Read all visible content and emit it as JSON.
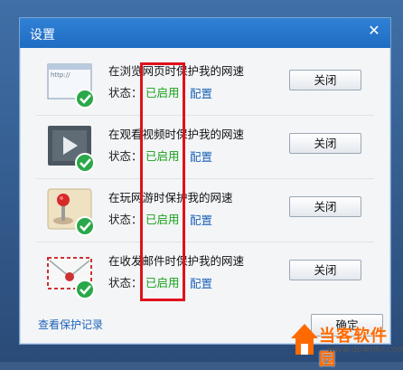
{
  "window": {
    "title": "设置",
    "close_glyph": "✕"
  },
  "rows": [
    {
      "heading": "在浏览网页时保护我的网速",
      "status_label": "状态：",
      "status_value": "已启用",
      "config_label": "配置",
      "button_label": "关闭",
      "icon": "browser-icon"
    },
    {
      "heading": "在观看视频时保护我的网速",
      "status_label": "状态：",
      "status_value": "已启用",
      "config_label": "配置",
      "button_label": "关闭",
      "icon": "video-icon"
    },
    {
      "heading": "在玩网游时保护我的网速",
      "status_label": "状态：",
      "status_value": "已启用",
      "config_label": "配置",
      "button_label": "关闭",
      "icon": "game-icon"
    },
    {
      "heading": "在收发邮件时保护我的网速",
      "status_label": "状态：",
      "status_value": "已启用",
      "config_label": "配置",
      "button_label": "关闭",
      "icon": "mail-icon"
    }
  ],
  "browser_icon_url_text": "http://",
  "footer": {
    "history_link": "查看保护记录",
    "ok_button": "确定"
  },
  "watermark": {
    "text": "当客软件园",
    "url": "www.downkr.com"
  },
  "colors": {
    "titlebar": "#2477cf",
    "status_enabled": "#1a9f1a",
    "link": "#1f63b8",
    "highlight": "#e0111a"
  }
}
